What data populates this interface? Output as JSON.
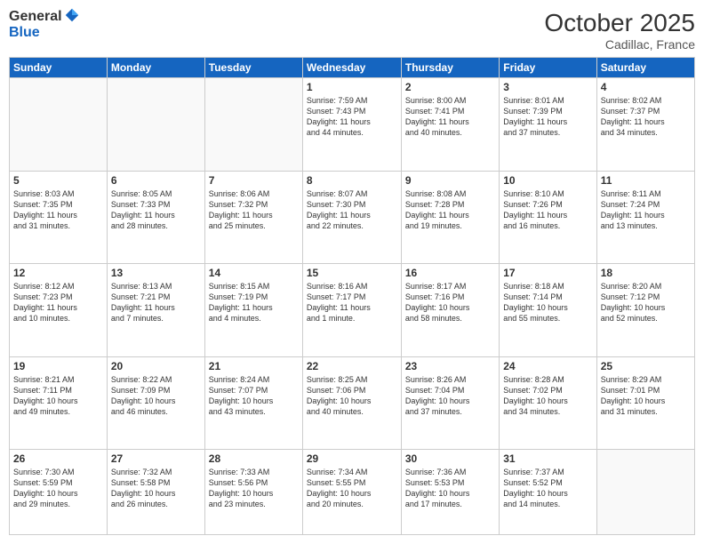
{
  "logo": {
    "general": "General",
    "blue": "Blue"
  },
  "header": {
    "month": "October 2025",
    "location": "Cadillac, France"
  },
  "days_of_week": [
    "Sunday",
    "Monday",
    "Tuesday",
    "Wednesday",
    "Thursday",
    "Friday",
    "Saturday"
  ],
  "weeks": [
    [
      {
        "num": "",
        "info": ""
      },
      {
        "num": "",
        "info": ""
      },
      {
        "num": "",
        "info": ""
      },
      {
        "num": "1",
        "info": "Sunrise: 7:59 AM\nSunset: 7:43 PM\nDaylight: 11 hours\nand 44 minutes."
      },
      {
        "num": "2",
        "info": "Sunrise: 8:00 AM\nSunset: 7:41 PM\nDaylight: 11 hours\nand 40 minutes."
      },
      {
        "num": "3",
        "info": "Sunrise: 8:01 AM\nSunset: 7:39 PM\nDaylight: 11 hours\nand 37 minutes."
      },
      {
        "num": "4",
        "info": "Sunrise: 8:02 AM\nSunset: 7:37 PM\nDaylight: 11 hours\nand 34 minutes."
      }
    ],
    [
      {
        "num": "5",
        "info": "Sunrise: 8:03 AM\nSunset: 7:35 PM\nDaylight: 11 hours\nand 31 minutes."
      },
      {
        "num": "6",
        "info": "Sunrise: 8:05 AM\nSunset: 7:33 PM\nDaylight: 11 hours\nand 28 minutes."
      },
      {
        "num": "7",
        "info": "Sunrise: 8:06 AM\nSunset: 7:32 PM\nDaylight: 11 hours\nand 25 minutes."
      },
      {
        "num": "8",
        "info": "Sunrise: 8:07 AM\nSunset: 7:30 PM\nDaylight: 11 hours\nand 22 minutes."
      },
      {
        "num": "9",
        "info": "Sunrise: 8:08 AM\nSunset: 7:28 PM\nDaylight: 11 hours\nand 19 minutes."
      },
      {
        "num": "10",
        "info": "Sunrise: 8:10 AM\nSunset: 7:26 PM\nDaylight: 11 hours\nand 16 minutes."
      },
      {
        "num": "11",
        "info": "Sunrise: 8:11 AM\nSunset: 7:24 PM\nDaylight: 11 hours\nand 13 minutes."
      }
    ],
    [
      {
        "num": "12",
        "info": "Sunrise: 8:12 AM\nSunset: 7:23 PM\nDaylight: 11 hours\nand 10 minutes."
      },
      {
        "num": "13",
        "info": "Sunrise: 8:13 AM\nSunset: 7:21 PM\nDaylight: 11 hours\nand 7 minutes."
      },
      {
        "num": "14",
        "info": "Sunrise: 8:15 AM\nSunset: 7:19 PM\nDaylight: 11 hours\nand 4 minutes."
      },
      {
        "num": "15",
        "info": "Sunrise: 8:16 AM\nSunset: 7:17 PM\nDaylight: 11 hours\nand 1 minute."
      },
      {
        "num": "16",
        "info": "Sunrise: 8:17 AM\nSunset: 7:16 PM\nDaylight: 10 hours\nand 58 minutes."
      },
      {
        "num": "17",
        "info": "Sunrise: 8:18 AM\nSunset: 7:14 PM\nDaylight: 10 hours\nand 55 minutes."
      },
      {
        "num": "18",
        "info": "Sunrise: 8:20 AM\nSunset: 7:12 PM\nDaylight: 10 hours\nand 52 minutes."
      }
    ],
    [
      {
        "num": "19",
        "info": "Sunrise: 8:21 AM\nSunset: 7:11 PM\nDaylight: 10 hours\nand 49 minutes."
      },
      {
        "num": "20",
        "info": "Sunrise: 8:22 AM\nSunset: 7:09 PM\nDaylight: 10 hours\nand 46 minutes."
      },
      {
        "num": "21",
        "info": "Sunrise: 8:24 AM\nSunset: 7:07 PM\nDaylight: 10 hours\nand 43 minutes."
      },
      {
        "num": "22",
        "info": "Sunrise: 8:25 AM\nSunset: 7:06 PM\nDaylight: 10 hours\nand 40 minutes."
      },
      {
        "num": "23",
        "info": "Sunrise: 8:26 AM\nSunset: 7:04 PM\nDaylight: 10 hours\nand 37 minutes."
      },
      {
        "num": "24",
        "info": "Sunrise: 8:28 AM\nSunset: 7:02 PM\nDaylight: 10 hours\nand 34 minutes."
      },
      {
        "num": "25",
        "info": "Sunrise: 8:29 AM\nSunset: 7:01 PM\nDaylight: 10 hours\nand 31 minutes."
      }
    ],
    [
      {
        "num": "26",
        "info": "Sunrise: 7:30 AM\nSunset: 5:59 PM\nDaylight: 10 hours\nand 29 minutes."
      },
      {
        "num": "27",
        "info": "Sunrise: 7:32 AM\nSunset: 5:58 PM\nDaylight: 10 hours\nand 26 minutes."
      },
      {
        "num": "28",
        "info": "Sunrise: 7:33 AM\nSunset: 5:56 PM\nDaylight: 10 hours\nand 23 minutes."
      },
      {
        "num": "29",
        "info": "Sunrise: 7:34 AM\nSunset: 5:55 PM\nDaylight: 10 hours\nand 20 minutes."
      },
      {
        "num": "30",
        "info": "Sunrise: 7:36 AM\nSunset: 5:53 PM\nDaylight: 10 hours\nand 17 minutes."
      },
      {
        "num": "31",
        "info": "Sunrise: 7:37 AM\nSunset: 5:52 PM\nDaylight: 10 hours\nand 14 minutes."
      },
      {
        "num": "",
        "info": ""
      }
    ]
  ]
}
